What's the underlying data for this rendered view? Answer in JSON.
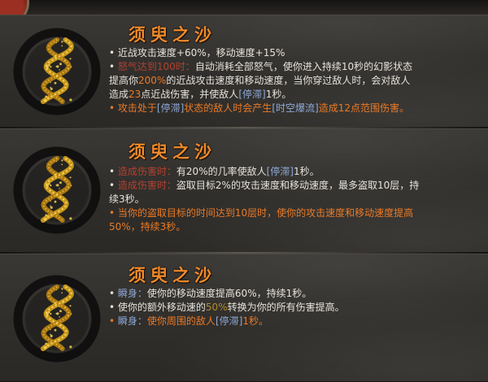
{
  "panels": [
    {
      "title": "须臾之沙",
      "emblem_icon": "golden-sand-helix-icon",
      "lines": [
        {
          "type": "bullet",
          "segments": [
            {
              "t": "近战攻击速度+60%，移动速度+15%",
              "c": ""
            }
          ]
        },
        {
          "type": "bullet",
          "segments": [
            {
              "t": "怒气达到100时：",
              "c": "h"
            },
            {
              "t": "自动消耗全部怒气，使你进入持续10秒的幻影状态",
              "c": ""
            }
          ]
        },
        {
          "type": "cont",
          "segments": [
            {
              "t": "提高你",
              "c": ""
            },
            {
              "t": "200%",
              "c": "o"
            },
            {
              "t": "的近战攻击速度和移动速度，当你穿过敌人时，会对敌人",
              "c": ""
            }
          ]
        },
        {
          "type": "cont",
          "segments": [
            {
              "t": "造成",
              "c": ""
            },
            {
              "t": "23",
              "c": "o"
            },
            {
              "t": "点近战伤害，并使敌人",
              "c": ""
            },
            {
              "t": "[停滞]",
              "c": "s"
            },
            {
              "t": "1秒。",
              "c": ""
            }
          ]
        },
        {
          "type": "bullet-orange",
          "segments": [
            {
              "t": "攻击处于",
              "c": "o"
            },
            {
              "t": "[停滞]",
              "c": "s"
            },
            {
              "t": "状态的敌人时会产生",
              "c": "o"
            },
            {
              "t": "[时空爆流]",
              "c": "s"
            },
            {
              "t": "造成12点范围伤害。",
              "c": "o"
            }
          ]
        }
      ]
    },
    {
      "title": "须臾之沙",
      "emblem_icon": "golden-sand-helix-icon",
      "lines": [
        {
          "type": "bullet",
          "segments": [
            {
              "t": "造成伤害时：",
              "c": "h"
            },
            {
              "t": "有20%的几率使敌人",
              "c": ""
            },
            {
              "t": "[停滞]",
              "c": "s"
            },
            {
              "t": "1秒。",
              "c": ""
            }
          ]
        },
        {
          "type": "bullet",
          "segments": [
            {
              "t": "造成伤害时：",
              "c": "h"
            },
            {
              "t": "盗取目标2%的攻击速度和移动速度，最多盗取10层，持",
              "c": ""
            }
          ]
        },
        {
          "type": "cont",
          "segments": [
            {
              "t": "续3秒。",
              "c": ""
            }
          ]
        },
        {
          "type": "bullet-orange",
          "segments": [
            {
              "t": "当你的盗取目标的时间达到10层时，使你的攻击速度和移动速度提高",
              "c": "o"
            }
          ]
        },
        {
          "type": "cont",
          "segments": [
            {
              "t": "50%，持续3秒。",
              "c": "o"
            }
          ]
        }
      ]
    },
    {
      "title": "须臾之沙",
      "emblem_icon": "golden-sand-helix-icon",
      "lines": [
        {
          "type": "bullet",
          "segments": [
            {
              "t": "瞬身：",
              "c": "s"
            },
            {
              "t": "使你的移动速度提高60%，持续1秒。",
              "c": ""
            }
          ]
        },
        {
          "type": "bullet",
          "segments": [
            {
              "t": "使你的额外移动速的",
              "c": ""
            },
            {
              "t": "50%",
              "c": "g"
            },
            {
              "t": "转换为你的所有伤害提高。",
              "c": ""
            }
          ]
        },
        {
          "type": "bullet-orange",
          "segments": [
            {
              "t": "瞬身：",
              "c": "s"
            },
            {
              "t": "使你周围的敌人",
              "c": "o"
            },
            {
              "t": "[停滞]",
              "c": "s"
            },
            {
              "t": "1秒。",
              "c": "o"
            }
          ]
        }
      ]
    }
  ],
  "colors": {
    "title": "#f08a2a",
    "text": "#e6e2dc",
    "highlight_orange": "#ea7a26",
    "trigger_red": "#b2412e",
    "status_blue": "#8fa9d8",
    "gold": "#b38a2a"
  },
  "bullet_char": "•"
}
